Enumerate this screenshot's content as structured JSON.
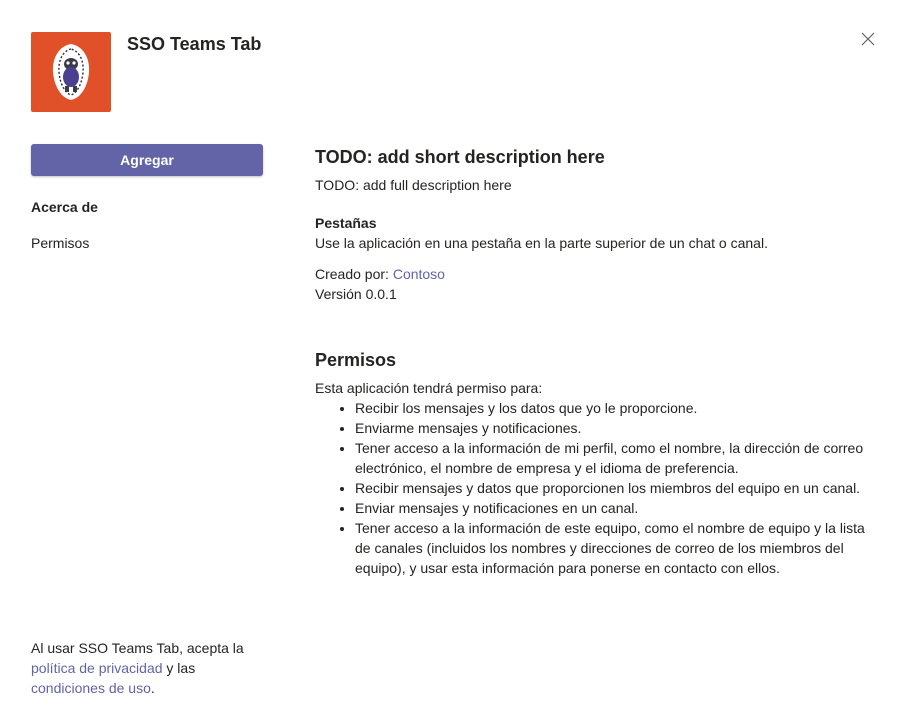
{
  "app": {
    "name": "SSO Teams Tab",
    "icon": "app-logo-icon",
    "icon_bg": "#e0512a"
  },
  "actions": {
    "add_label": "Agregar",
    "close_icon": "close-icon"
  },
  "nav": {
    "items": [
      {
        "label": "Acerca de",
        "active": true
      },
      {
        "label": "Permisos",
        "active": false
      }
    ]
  },
  "about": {
    "short_description": "TODO: add short description here",
    "full_description": "TODO: add full description here",
    "tabs_heading": "Pestañas",
    "tabs_text": "Use la aplicación en una pestaña en la parte superior de un chat o canal.",
    "created_by_label": "Creado por:",
    "created_by_name": "Contoso",
    "version": "Versión 0.0.1"
  },
  "permissions": {
    "heading": "Permisos",
    "intro": "Esta aplicación tendrá permiso para:",
    "items": [
      "Recibir los mensajes y los datos que yo le proporcione.",
      "Enviarme mensajes y notificaciones.",
      "Tener acceso a la información de mi perfil, como el nombre, la dirección de correo electrónico, el nombre de empresa y el idioma de preferencia.",
      "Recibir mensajes y datos que proporcionen los miembros del equipo en un canal.",
      "Enviar mensajes y notificaciones en un canal.",
      "Tener acceso a la información de este equipo, como el nombre de equipo y la lista de canales (incluidos los nombres y direcciones de correo de los miembros del equipo), y usar esta información para ponerse en contacto con ellos."
    ]
  },
  "footer": {
    "prefix": "Al usar SSO Teams Tab, acepta la",
    "privacy_link": "política de privacidad",
    "middle": "y las",
    "terms_link": "condiciones de uso",
    "suffix": "."
  },
  "colors": {
    "accent": "#6264a7",
    "text": "#252423"
  }
}
